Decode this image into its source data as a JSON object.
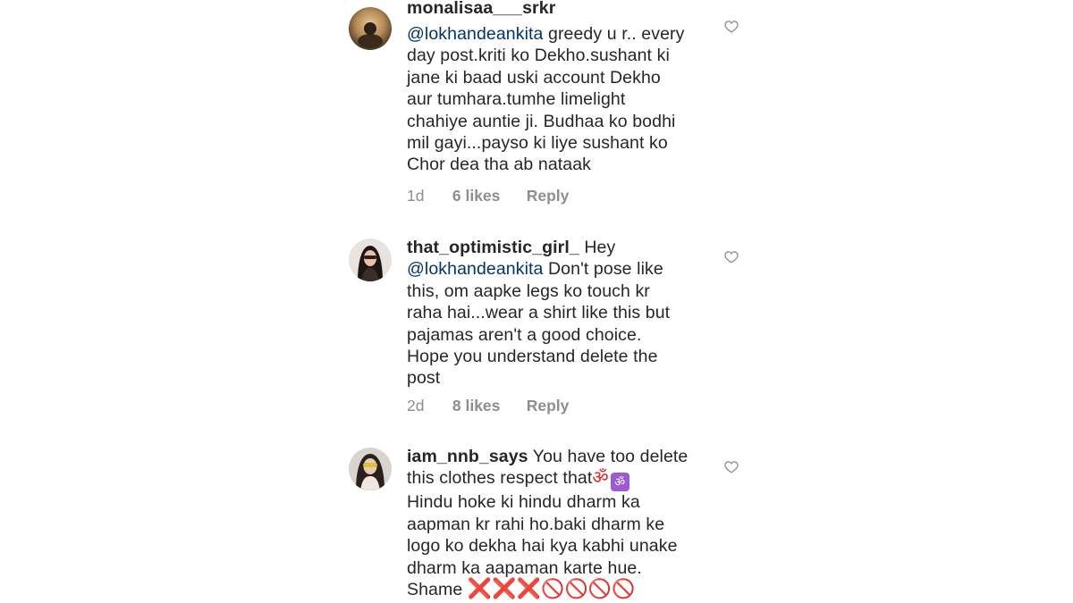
{
  "comments": [
    {
      "username": "monalisaa___srkr",
      "mention": "@lokhandeankita",
      "first_line_rest": " greedy u r.. every",
      "lines": [
        "day post.kriti ko Dekho.sushant ki",
        "jane ki baad uski account Dekho",
        "aur tumhara.tumhe limelight",
        "chahiye auntie ji. Budhaa ko bodhi",
        "mil gayi...payso ki liye sushant ko",
        "Chor dea tha ab nataak"
      ],
      "time": "1d",
      "likes": "6 likes",
      "reply": "Reply",
      "icon": "heart-outline-icon"
    },
    {
      "username": "that_optimistic_girl_",
      "first_line_rest": " Hey",
      "mention": "@lokhandeankita",
      "second_line_rest": " Don't pose like",
      "lines": [
        "this, om aapke legs ko touch kr",
        "raha hai...wear a shirt like this but",
        "pajamas aren't a good choice.",
        "Hope you understand delete the",
        "post"
      ],
      "time": "2d",
      "likes": "8 likes",
      "reply": "Reply",
      "icon": "heart-outline-icon"
    },
    {
      "username": "iam_nnb_says",
      "first_line_rest": " You have too delete",
      "second_line_text": "this clothes respect that",
      "second_line_emoji_a": "ॐ",
      "second_line_emoji_b": "ॐ",
      "lines": [
        "Hindu hoke ki hindu dharm ka",
        "aapman kr rahi ho.baki dharm ke",
        "logo ko dekha hai kya kabhi unake",
        "dharm ka aapaman karte hue."
      ],
      "last_word": "Shame",
      "crosses": "❌❌❌",
      "prohibited": "🚫🚫🚫🚫",
      "icon": "heart-outline-icon"
    }
  ],
  "colors": {
    "text": "#262626",
    "mention": "#003569",
    "meta": "#8e8e8e",
    "heart": "#8e8e8e",
    "emoji_red": "#e0202a",
    "om_purple": "#9b5bd1"
  }
}
